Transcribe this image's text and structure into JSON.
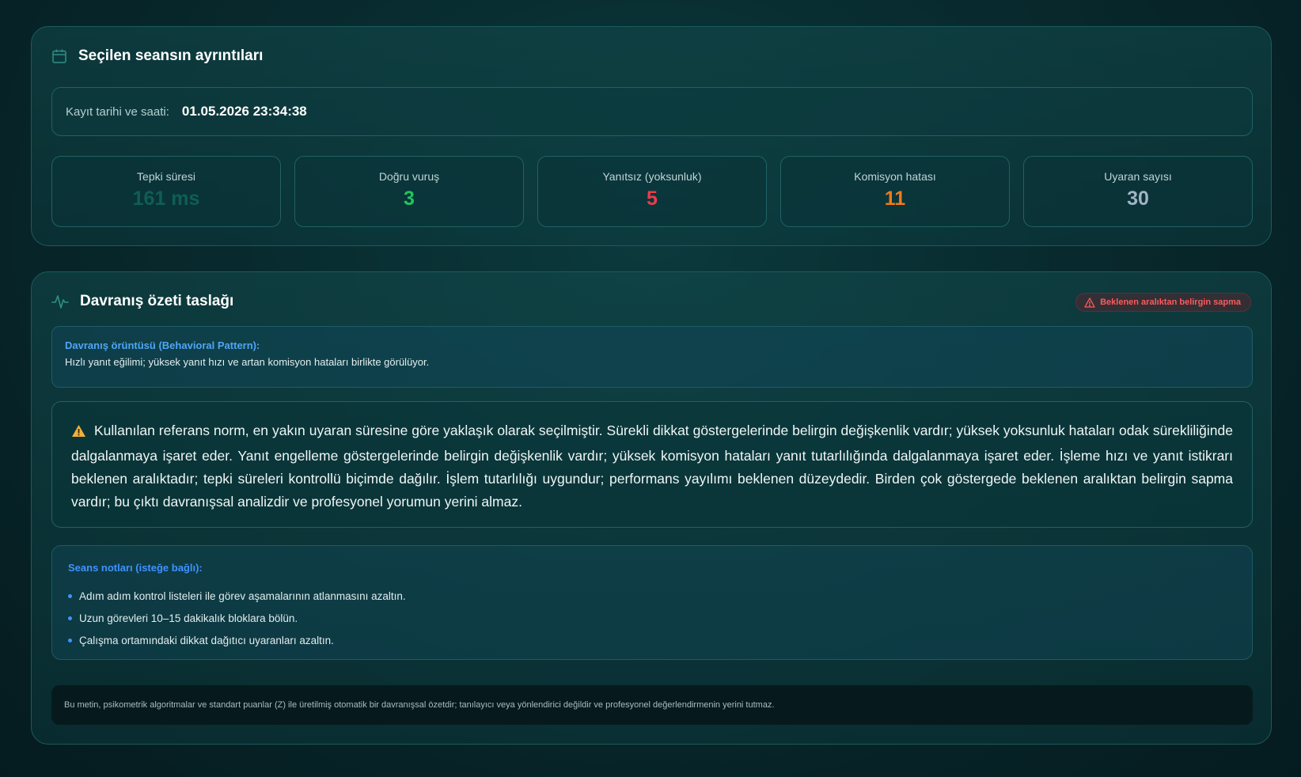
{
  "session": {
    "title": "Seçilen seansın ayrıntıları",
    "datetime_label": "Kayıt tarihi ve saati:",
    "datetime_value": "01.05.2026 23:34:38",
    "stats": [
      {
        "label": "Tepki süresi",
        "value": "161 ms",
        "color": "#0f5e55"
      },
      {
        "label": "Doğru vuruş",
        "value": "3",
        "color": "#22c55e"
      },
      {
        "label": "Yanıtsız (yoksunluk)",
        "value": "5",
        "color": "#ef3b4a"
      },
      {
        "label": "Komisyon hatası",
        "value": "11",
        "color": "#f07a1a"
      },
      {
        "label": "Uyaran sayısı",
        "value": "30",
        "color": "#9fb4c4"
      }
    ]
  },
  "summary": {
    "title": "Davranış özeti taslağı",
    "badge": "Beklenen aralıktan belirgin sapma",
    "pattern_title": "Davranış örüntüsü (Behavioral Pattern):",
    "pattern_text": "Hızlı yanıt eğilimi; yüksek yanıt hızı ve artan komisyon hataları birlikte görülüyor.",
    "text": "Kullanılan referans norm, en yakın uyaran süresine göre yaklaşık olarak seçilmiştir. Sürekli dikkat göstergelerinde belirgin değişkenlik vardır; yüksek yoksunluk hataları odak sürekliliğinde dalgalanmaya işaret eder. Yanıt engelleme göstergelerinde belirgin değişkenlik vardır; yüksek komisyon hataları yanıt tutarlılığında dalgalanmaya işaret eder. İşleme hızı ve yanıt istikrarı beklenen aralıktadır; tepki süreleri kontrollü biçimde dağılır. İşlem tutarlılığı uygundur; performans yayılımı beklenen düzeydedir. Birden çok göstergede beklenen aralıktan belirgin sapma vardır; bu çıktı davranışsal analizdir ve profesyonel yorumun yerini almaz.",
    "notes_title": "Seans notları (isteğe bağlı):",
    "notes": [
      "Adım adım kontrol listeleri ile görev aşamalarının atlanmasını azaltın.",
      "Uzun görevleri 10–15 dakikalık bloklara bölün.",
      "Çalışma ortamındaki dikkat dağıtıcı uyaranları azaltın."
    ],
    "disclaimer": "Bu metin, psikometrik algoritmalar ve standart puanlar (Z) ile üretilmiş otomatik bir davranışsal özetdir; tanılayıcı veya yönlendirici değildir ve profesyonel değerlendirmenin yerini tutmaz."
  },
  "icons": {
    "header_1": "calendar-icon",
    "header_2": "activity-icon",
    "badge": "warning-triangle-icon",
    "summary": "warning-icon"
  }
}
